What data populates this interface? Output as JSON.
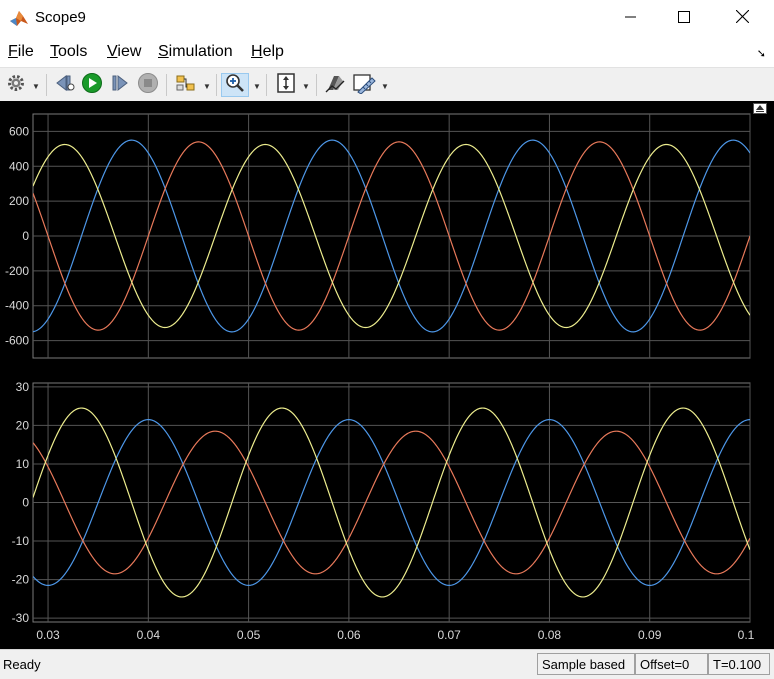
{
  "window": {
    "title": "Scope9",
    "icons": [
      "matlab-logo-icon",
      "minimize-icon",
      "maximize-icon",
      "close-icon"
    ]
  },
  "menu": {
    "items": [
      {
        "label": "File",
        "ul": "F",
        "rest": "ile"
      },
      {
        "label": "Tools",
        "ul": "T",
        "rest": "ools"
      },
      {
        "label": "View",
        "ul": "V",
        "rest": "iew"
      },
      {
        "label": "Simulation",
        "ul": "S",
        "rest": "imulation"
      },
      {
        "label": "Help",
        "ul": "H",
        "rest": "elp"
      }
    ]
  },
  "toolbar": {
    "icons": [
      "settings-gear-icon",
      "step-back-icon",
      "run-icon",
      "step-forward-icon",
      "stop-icon",
      "highlight-simulink-block-icon",
      "zoom-in-icon",
      "scale-axes-icon",
      "style-icon",
      "measurement-ruler-icon"
    ],
    "accent": "#1a9a2a",
    "active_tool": "zoom-in-icon"
  },
  "status": {
    "ready": "Ready",
    "sample": "Sample based",
    "offset": "Offset=0",
    "time": "T=0.100"
  },
  "colors": {
    "blue": "#4d97e8",
    "orange": "#e8795a",
    "yellow": "#eded8e",
    "axes_bg": "#000000",
    "grid": "#555555",
    "tick_label": "#d9d9d9"
  },
  "chart_data": [
    {
      "type": "line",
      "title": "",
      "xlabel": "",
      "ylabel": "",
      "xlim": [
        0.0285,
        0.1
      ],
      "ylim": [
        -700,
        700
      ],
      "yticks": [
        -600,
        -400,
        -200,
        0,
        200,
        400,
        600
      ],
      "xticks": [
        0.03,
        0.04,
        0.05,
        0.06,
        0.07,
        0.08,
        0.09,
        0.1
      ],
      "grid": true,
      "frequency_hz": 50,
      "series": [
        {
          "color": "#4d97e8",
          "amplitude": 550,
          "phase_deg": 30
        },
        {
          "color": "#e8795a",
          "amplitude": 540,
          "phase_deg": -90
        },
        {
          "color": "#eded8e",
          "amplitude": 525,
          "phase_deg": 150
        }
      ]
    },
    {
      "type": "line",
      "title": "",
      "xlabel": "",
      "ylabel": "",
      "xlim": [
        0.0285,
        0.1
      ],
      "ylim": [
        -31,
        31
      ],
      "yticks": [
        -30,
        -20,
        -10,
        0,
        10,
        20,
        30
      ],
      "xticks": [
        0.03,
        0.04,
        0.05,
        0.06,
        0.07,
        0.08,
        0.09,
        0.1
      ],
      "xticklabels": [
        "0.03",
        "0.04",
        "0.05",
        "0.06",
        "0.07",
        "0.08",
        "0.09",
        "0.1"
      ],
      "grid": true,
      "frequency_hz": 50,
      "series": [
        {
          "color": "#4d97e8",
          "amplitude": 21.5,
          "phase_deg": 0
        },
        {
          "color": "#e8795a",
          "amplitude": 18.5,
          "phase_deg": -120
        },
        {
          "color": "#eded8e",
          "amplitude": 24.5,
          "phase_deg": 120
        }
      ]
    }
  ]
}
